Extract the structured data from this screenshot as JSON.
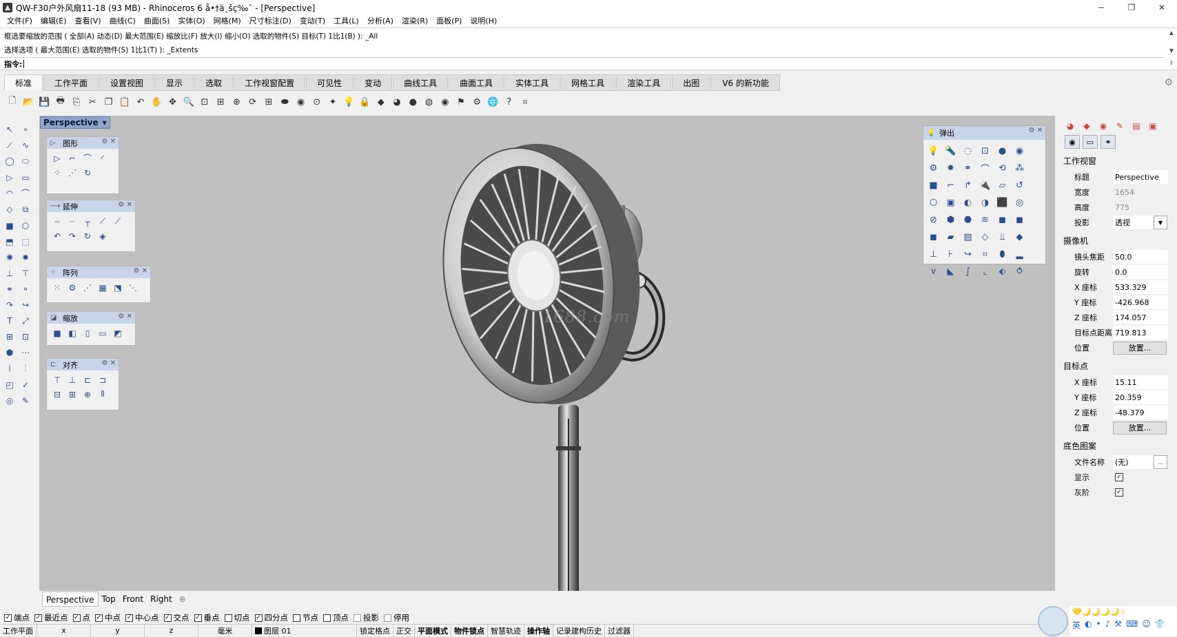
{
  "window": {
    "title": "QW-F30户外风扇11-18 (93 MB) - Rhinoceros 6 å•†ä¸šç‰ˆ - [Perspective]",
    "minimize": "─",
    "maximize": "❐",
    "close": "✕"
  },
  "menu": [
    "文件(F)",
    "编辑(E)",
    "查看(V)",
    "曲线(C)",
    "曲面(S)",
    "实体(O)",
    "网格(M)",
    "尺寸标注(D)",
    "变动(T)",
    "工具(L)",
    "分析(A)",
    "渲染(R)",
    "面板(P)",
    "说明(H)"
  ],
  "command": {
    "history_1": "框选要缩放的范围 ( 全部(A)  动态(D)  最大范围(E)  缩放比(F)  放大(I)  缩小(O)  选取的物件(S)  目标(T)  1比1(B) ): _All",
    "history_2": "选择选项 ( 最大范围(E)  选取的物件(S)  1比1(T) ): _Extents",
    "prompt": "指令:"
  },
  "tabs": [
    "标准",
    "工作平面",
    "设置视图",
    "显示",
    "选取",
    "工作视窗配置",
    "可见性",
    "变动",
    "曲线工具",
    "曲面工具",
    "实体工具",
    "网格工具",
    "渲染工具",
    "出图",
    "V6 的新功能"
  ],
  "toolbar_icons": [
    "new-file-icon",
    "open-folder-icon",
    "save-icon",
    "print-icon",
    "import-icon",
    "cut-icon",
    "copy-icon",
    "paste-icon",
    "undo-icon",
    "pan-hand-icon",
    "move-view-icon",
    "zoom-icon",
    "zoom-window-icon",
    "zoom-extents-icon",
    "zoom-selected-icon",
    "rotate-view-icon",
    "four-view-icon",
    "named-view-icon",
    "camera-icon",
    "target-icon",
    "snap-icon",
    "light-icon",
    "lock-icon",
    "material-icon",
    "color-wheel-icon",
    "sphere-shaded-icon",
    "sphere-render-icon",
    "sphere-blue-icon",
    "flag-icon",
    "gear-tools-icon",
    "globe-icon",
    "help-icon",
    "grid-snap-icon"
  ],
  "viewport": {
    "name": "Perspective",
    "watermark": "1688.com"
  },
  "panels": {
    "draw": {
      "title": "图形"
    },
    "extend": {
      "title": "延伸"
    },
    "array": {
      "title": "阵列"
    },
    "scale": {
      "title": "缩放"
    },
    "align": {
      "title": "对齐"
    },
    "popup": {
      "title": "弹出"
    }
  },
  "properties": {
    "viewport_section": "工作视窗",
    "title_label": "标题",
    "title_value": "Perspective",
    "width_label": "宽度",
    "width_value": "1654",
    "height_label": "高度",
    "height_value": "775",
    "projection_label": "投影",
    "projection_value": "透视",
    "camera_section": "摄像机",
    "lens_label": "镜头焦距",
    "lens_value": "50.0",
    "rotation_label": "旋转",
    "rotation_value": "0.0",
    "cx_label": "X 座标",
    "cx_value": "533.329",
    "cy_label": "Y 座标",
    "cy_value": "-426.968",
    "cz_label": "Z 座标",
    "cz_value": "174.057",
    "target_dist_label": "目标点距离",
    "target_dist_value": "719.813",
    "location_label": "位置",
    "place_button": "放置...",
    "target_section": "目标点",
    "tx_label": "X 座标",
    "tx_value": "15.11",
    "ty_label": "Y 座标",
    "ty_value": "20.359",
    "tz_label": "Z 座标",
    "tz_value": "-48.379",
    "target_location_label": "位置",
    "target_place_button": "放置...",
    "wallpaper_section": "底色图案",
    "filename_label": "文件名称",
    "filename_value": "(无)",
    "browse_button": "...",
    "show_label": "显示",
    "gray_label": "灰阶"
  },
  "viewport_tabs": [
    "Perspective",
    "Top",
    "Front",
    "Right"
  ],
  "viewport_tab_add": "⊕",
  "osnaps": [
    {
      "label": "端点",
      "checked": true
    },
    {
      "label": "最近点",
      "checked": true
    },
    {
      "label": "点",
      "checked": true
    },
    {
      "label": "中点",
      "checked": true
    },
    {
      "label": "中心点",
      "checked": true
    },
    {
      "label": "交点",
      "checked": true
    },
    {
      "label": "垂点",
      "checked": true
    },
    {
      "label": "切点",
      "checked": false
    },
    {
      "label": "四分点",
      "checked": true
    },
    {
      "label": "节点",
      "checked": false
    },
    {
      "label": "顶点",
      "checked": false
    },
    {
      "label": "投影",
      "checked": false
    },
    {
      "label": "停用",
      "checked": false
    }
  ],
  "status": {
    "cplane": "工作平面",
    "x": "x",
    "y": "y",
    "z": "z",
    "unit": "毫米",
    "layer": "图层 01",
    "grid_snap": "锁定格点",
    "ortho": "正交",
    "planar": "平面模式",
    "osnap": "物件锁点",
    "smarttrack": "智慧轨迹",
    "gumball": "操作轴",
    "history": "记录建构历史",
    "filter": "过滤器"
  },
  "ime": {
    "top": "💛🌙🌙🌙🌙☆",
    "lang": "英"
  }
}
